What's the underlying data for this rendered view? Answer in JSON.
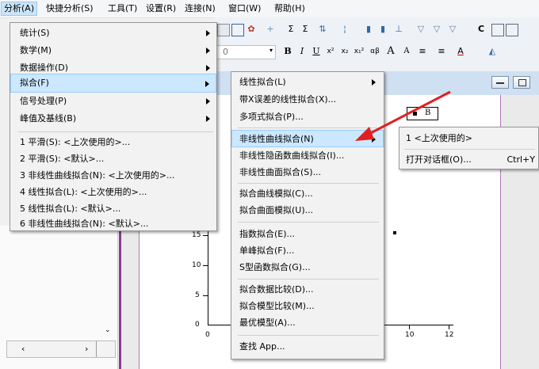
{
  "menubar": {
    "items": [
      {
        "label": "分析(A)"
      },
      {
        "label": "快捷分析(S)"
      },
      {
        "label": "工具(T)"
      },
      {
        "label": "设置(R)"
      },
      {
        "label": "连接(N)"
      },
      {
        "label": "窗口(W)"
      },
      {
        "label": "帮助(H)"
      }
    ]
  },
  "toolbar": {
    "font_size_value": "0",
    "format_labels": [
      "B",
      "I",
      "U",
      "x²",
      "x₂",
      "x₁²",
      "αβ",
      "A",
      "A",
      "≡",
      "≡",
      "A"
    ]
  },
  "analysis_menu": {
    "items": [
      {
        "label": "统计(S)",
        "submenu": true
      },
      {
        "label": "数学(M)",
        "submenu": true
      },
      {
        "label": "数据操作(D)",
        "submenu": true
      },
      {
        "label": "拟合(F)",
        "submenu": true
      },
      {
        "label": "信号处理(P)",
        "submenu": true
      },
      {
        "label": "峰值及基线(B)",
        "submenu": true
      }
    ],
    "recent": [
      "1 平滑(S): <上次使用的>...",
      "2 平滑(S): <默认>...",
      "3 非线性曲线拟合(N): <上次使用的>...",
      "4 线性拟合(L): <上次使用的>...",
      "5 线性拟合(L): <默认>...",
      "6 非线性曲线拟合(N): <默认>..."
    ]
  },
  "fit_menu": {
    "groups": [
      [
        "线性拟合(L)",
        "带X误差的线性拟合(X)...",
        "多项式拟合(P)..."
      ],
      [
        "非线性曲线拟合(N)",
        "非线性隐函数曲线拟合(I)...",
        "非线性曲面拟合(S)..."
      ],
      [
        "拟合曲线模拟(C)...",
        "拟合曲面模拟(U)..."
      ],
      [
        "指数拟合(E)...",
        "单峰拟合(F)...",
        "S型函数拟合(G)..."
      ],
      [
        "拟合数据比较(D)...",
        "拟合模型比较(M)...",
        "最优模型(A)..."
      ],
      [
        "查找 App..."
      ]
    ]
  },
  "nlfit_menu": {
    "items": [
      {
        "label": "1 <上次使用的>",
        "shortcut": ""
      },
      {
        "label": "打开对话框(O)...",
        "shortcut": "Ctrl+Y"
      }
    ]
  },
  "graph": {
    "legend_label": "B",
    "y_ticks": [
      "15",
      "10",
      "5",
      "0"
    ],
    "x_ticks": [
      "0",
      "10",
      "12"
    ]
  },
  "colors": {
    "highlight": "#cce8ff",
    "annotation_arrow": "#e02020",
    "window_border": "#8a3d91"
  }
}
